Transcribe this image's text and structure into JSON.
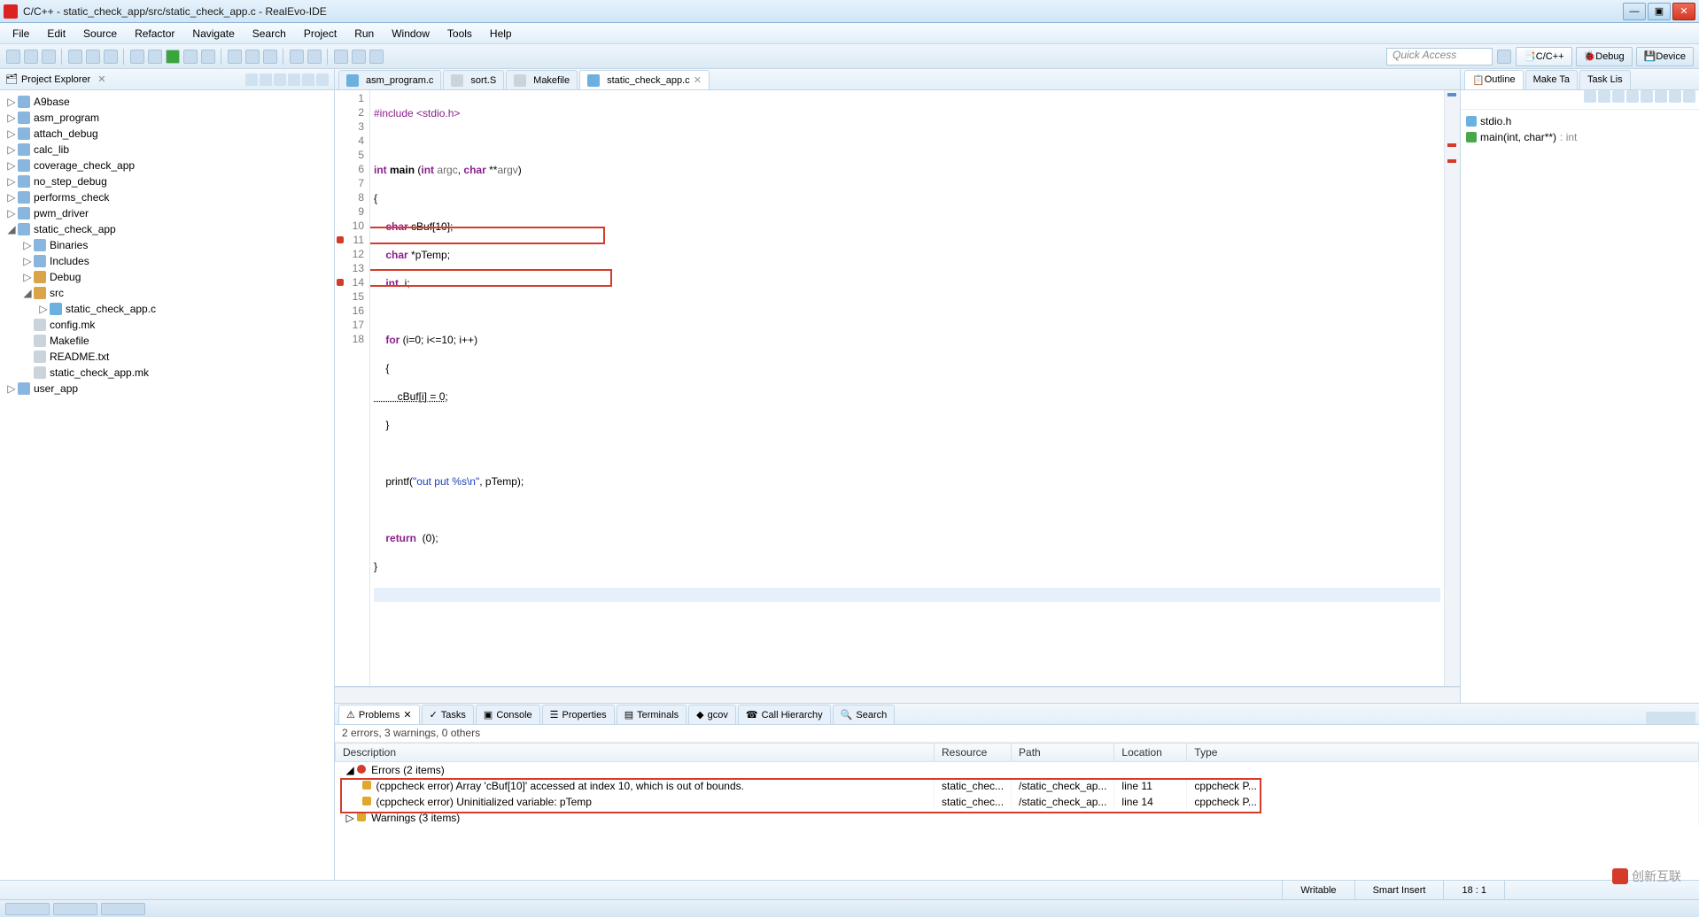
{
  "window": {
    "title": "C/C++ - static_check_app/src/static_check_app.c - RealEvo-IDE"
  },
  "menubar": [
    "File",
    "Edit",
    "Source",
    "Refactor",
    "Navigate",
    "Search",
    "Project",
    "Run",
    "Window",
    "Tools",
    "Help"
  ],
  "toolbar_right": {
    "quick_access": "Quick Access",
    "perspectives": [
      "C/C++",
      "Debug",
      "Device"
    ]
  },
  "project_explorer": {
    "title": "Project Explorer",
    "tree": [
      {
        "label": "A9base",
        "depth": 0,
        "tw": "▷",
        "icon": "folder-c"
      },
      {
        "label": "asm_program",
        "depth": 0,
        "tw": "▷",
        "icon": "folder-c"
      },
      {
        "label": "attach_debug",
        "depth": 0,
        "tw": "▷",
        "icon": "folder-c"
      },
      {
        "label": "calc_lib",
        "depth": 0,
        "tw": "▷",
        "icon": "folder-c"
      },
      {
        "label": "coverage_check_app",
        "depth": 0,
        "tw": "▷",
        "icon": "folder-c"
      },
      {
        "label": "no_step_debug",
        "depth": 0,
        "tw": "▷",
        "icon": "folder-c"
      },
      {
        "label": "performs_check",
        "depth": 0,
        "tw": "▷",
        "icon": "folder-c"
      },
      {
        "label": "pwm_driver",
        "depth": 0,
        "tw": "▷",
        "icon": "folder-c"
      },
      {
        "label": "static_check_app",
        "depth": 0,
        "tw": "◢",
        "icon": "folder-c"
      },
      {
        "label": "Binaries",
        "depth": 1,
        "tw": "▷",
        "icon": "folder-c"
      },
      {
        "label": "Includes",
        "depth": 1,
        "tw": "▷",
        "icon": "folder-c"
      },
      {
        "label": "Debug",
        "depth": 1,
        "tw": "▷",
        "icon": "folder-icon"
      },
      {
        "label": "src",
        "depth": 1,
        "tw": "◢",
        "icon": "folder-icon"
      },
      {
        "label": "static_check_app.c",
        "depth": 2,
        "tw": "▷",
        "icon": "file-c"
      },
      {
        "label": "config.mk",
        "depth": 1,
        "tw": "",
        "icon": "file-plain"
      },
      {
        "label": "Makefile",
        "depth": 1,
        "tw": "",
        "icon": "file-plain"
      },
      {
        "label": "README.txt",
        "depth": 1,
        "tw": "",
        "icon": "file-plain"
      },
      {
        "label": "static_check_app.mk",
        "depth": 1,
        "tw": "",
        "icon": "file-plain"
      },
      {
        "label": "user_app",
        "depth": 0,
        "tw": "▷",
        "icon": "folder-c"
      }
    ]
  },
  "editor": {
    "tabs": [
      {
        "label": "asm_program.c",
        "active": false
      },
      {
        "label": "sort.S",
        "active": false
      },
      {
        "label": "Makefile",
        "active": false
      },
      {
        "label": "static_check_app.c",
        "active": true
      }
    ],
    "code": {
      "l1_a": "#include",
      "l1_b": "<stdio.h>",
      "l3_a": "int",
      "l3_b": "main",
      "l3_c": "(",
      "l3_d": "int",
      "l3_e": "argc",
      "l3_f": ", ",
      "l3_g": "char",
      "l3_h": " **",
      "l3_i": "argv",
      "l3_j": ")",
      "l4": "{",
      "l5_a": "    ",
      "l5_b": "char",
      "l5_c": " cBuf[10];",
      "l6_a": "    ",
      "l6_b": "char",
      "l6_c": " *pTemp;",
      "l7_a": "    ",
      "l7_b": "int",
      "l7_c": "  i;",
      "l9_a": "    ",
      "l9_b": "for",
      "l9_c": " (i=0; i<=10; i++)",
      "l10": "    {",
      "l11": "        cBuf[i] = 0;",
      "l12": "    }",
      "l14_a": "    printf(",
      "l14_b": "\"out put %s\\n\"",
      "l14_c": ", pTemp);",
      "l16_a": "    ",
      "l16_b": "return",
      "l16_c": "  (0);",
      "l17": "}"
    },
    "line_numbers": [
      "1",
      "2",
      "3",
      "4",
      "5",
      "6",
      "7",
      "8",
      "9",
      "10",
      "11",
      "12",
      "13",
      "14",
      "15",
      "16",
      "17",
      "18"
    ],
    "error_lines": [
      11,
      14
    ]
  },
  "outline": {
    "tabs": [
      "Outline",
      "Make Ta",
      "Task Lis"
    ],
    "items": [
      {
        "label": "stdio.h",
        "ret": ""
      },
      {
        "label": "main(int, char**)",
        "ret": " : int"
      }
    ]
  },
  "bottom": {
    "tabs": [
      "Problems",
      "Tasks",
      "Console",
      "Properties",
      "Terminals",
      "gcov",
      "Call Hierarchy",
      "Search"
    ],
    "active_tab": 0,
    "summary": "2 errors, 3 warnings, 0 others",
    "columns": [
      "Description",
      "Resource",
      "Path",
      "Location",
      "Type"
    ],
    "errors_header": "Errors (2 items)",
    "warnings_header": "Warnings (3 items)",
    "errors": [
      {
        "desc": "(cppcheck error) Array 'cBuf[10]' accessed at index 10, which is out of bounds.",
        "resource": "static_chec...",
        "path": "/static_check_ap...",
        "location": "line 11",
        "type": "cppcheck P..."
      },
      {
        "desc": "(cppcheck error) Uninitialized variable: pTemp",
        "resource": "static_chec...",
        "path": "/static_check_ap...",
        "location": "line 14",
        "type": "cppcheck P..."
      }
    ]
  },
  "statusbar": {
    "writable": "Writable",
    "insert": "Smart Insert",
    "pos": "18 : 1"
  },
  "watermark": "创新互联"
}
